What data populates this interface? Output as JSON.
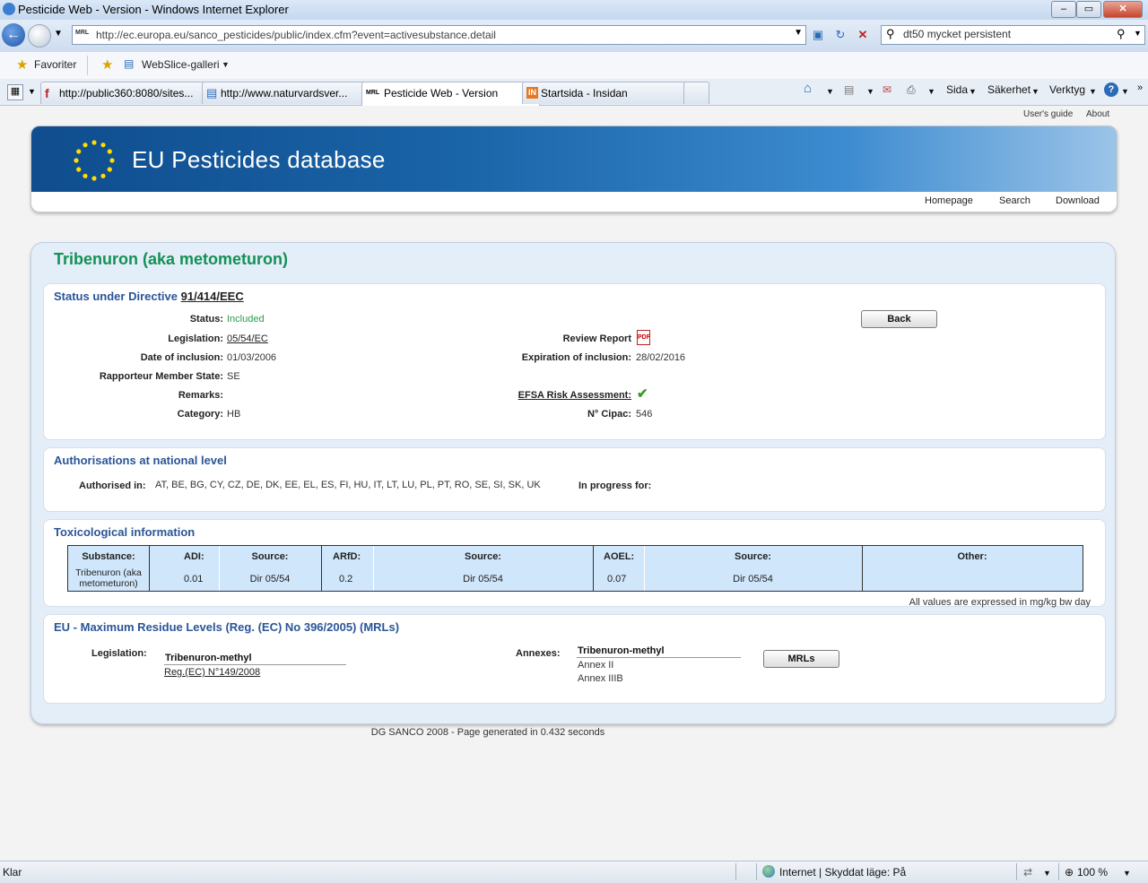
{
  "window": {
    "title": "Pesticide Web - Version - Windows Internet Explorer",
    "min": "–",
    "max": "▭",
    "close": "✕"
  },
  "addressbar": {
    "url": "http://ec.europa.eu/sanco_pesticides/public/index.cfm?event=activesubstance.detail",
    "favicon_text": "MRL",
    "search_value": "dt50 mycket persistent"
  },
  "favorites": {
    "favorites_label": "Favoriter",
    "webslice_label": "WebSlice-galleri"
  },
  "tabs": [
    {
      "label": "http://public360:8080/sites..."
    },
    {
      "label": "http://www.naturvardsver..."
    },
    {
      "label": "Pesticide Web - Version"
    },
    {
      "label": "Startsida - Insidan"
    }
  ],
  "ie_toolbar": {
    "page": "Sida",
    "safety": "Säkerhet",
    "tools": "Verktyg"
  },
  "site": {
    "top_links": {
      "users_guide": "User's guide",
      "about": "About"
    },
    "banner_title": "EU Pesticides database",
    "nav": {
      "homepage": "Homepage",
      "search": "Search",
      "download": "Download"
    },
    "substance_title": "Tribenuron (aka metometuron)"
  },
  "status": {
    "heading": "Status under Directive",
    "heading_link": "91/414/EEC",
    "back_button": "Back",
    "fields": {
      "status_label": "Status:",
      "status_value": "Included",
      "legislation_label": "Legislation:",
      "legislation_value": "05/54/EC",
      "date_label": "Date of inclusion:",
      "date_value": "01/03/2006",
      "rms_label": "Rapporteur Member State:",
      "rms_value": "SE",
      "remarks_label": "Remarks:",
      "category_label": "Category:",
      "category_value": "HB",
      "review_label": "Review Report",
      "expiration_label": "Expiration of inclusion:",
      "expiration_value": "28/02/2016",
      "efsa_label": "EFSA Risk Assessment:",
      "cipac_label": "N° Cipac:",
      "cipac_value": "546"
    }
  },
  "authorisations": {
    "heading": "Authorisations at national level",
    "authorised_label": "Authorised in:",
    "authorised_value": "AT, BE, BG, CY, CZ, DE, DK, EE, EL, ES, FI, HU, IT, LT, LU, PL, PT, RO, SE, SI, SK, UK",
    "progress_label": "In progress for:"
  },
  "toxicology": {
    "heading": "Toxicological information",
    "headers": {
      "substance": "Substance:",
      "adi": "ADI:",
      "source1": "Source:",
      "arfd": "ARfD:",
      "source2": "Source:",
      "aoel": "AOEL:",
      "source3": "Source:",
      "other": "Other:"
    },
    "row": {
      "substance": "Tribenuron (aka metometuron)",
      "adi": "0.01",
      "source1": "Dir 05/54",
      "arfd": "0.2",
      "source2": "Dir 05/54",
      "aoel": "0.07",
      "source3": "Dir 05/54"
    },
    "note": "All values are expressed in mg/kg bw day"
  },
  "mrl": {
    "heading": "EU - Maximum Residue Levels (Reg. (EC) No 396/2005) (MRLs)",
    "legislation_label": "Legislation:",
    "legislation_substance": "Tribenuron-methyl",
    "legislation_link": "Reg.(EC) N°149/2008",
    "annexes_label": "Annexes:",
    "annexes_substance": "Tribenuron-methyl",
    "annex1": "Annex II",
    "annex2": "Annex IIIB",
    "mrl_button": "MRLs"
  },
  "footer": "DG SANCO 2008 - Page generated in 0.432 seconds",
  "statusbar": {
    "left": "Klar",
    "zone": "Internet | Skyddat läge: På",
    "zoom": "100 %"
  },
  "colors": {
    "title_green": "#149056",
    "heading_blue": "#2a5597",
    "included_green": "#2a9d4a",
    "table_bg": "#cfe6fb"
  }
}
